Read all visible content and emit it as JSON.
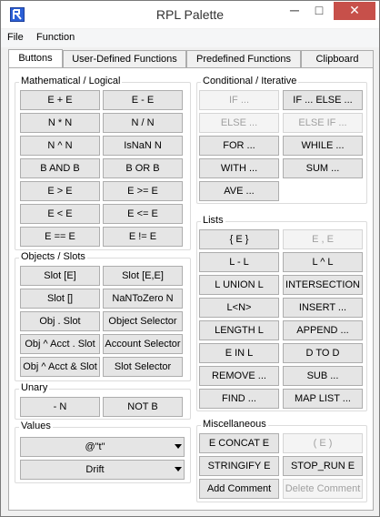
{
  "window": {
    "title": "RPL Palette",
    "min": "─",
    "max": "□",
    "close": "✕"
  },
  "menu": [
    "File",
    "Function"
  ],
  "tabs": [
    "Buttons",
    "User-Defined Functions",
    "Predefined Functions",
    "Clipboard"
  ],
  "groups": {
    "math": {
      "title": "Mathematical / Logical",
      "buttons": [
        "E + E",
        "E - E",
        "N * N",
        "N / N",
        "N ^ N",
        "IsNaN N",
        "B AND B",
        "B OR B",
        "E > E",
        "E >= E",
        "E < E",
        "E <= E",
        "E == E",
        "E != E"
      ]
    },
    "objects": {
      "title": "Objects / Slots",
      "buttons": [
        "Slot [E]",
        "Slot [E,E]",
        "Slot []",
        "NaNToZero N",
        "Obj . Slot",
        "Object Selector",
        "Obj ^ Acct . Slot",
        "Account Selector",
        "Obj ^ Acct & Slot",
        "Slot Selector"
      ]
    },
    "unary": {
      "title": "Unary",
      "buttons": [
        "- N",
        "NOT B"
      ]
    },
    "values": {
      "title": "Values",
      "combos": [
        "@\"t\"",
        "Drift"
      ]
    },
    "conditional": {
      "title": "Conditional / Iterative",
      "buttons": [
        "IF ...",
        "IF ... ELSE ...",
        "ELSE ...",
        "ELSE IF ...",
        "FOR ...",
        "WHILE ...",
        "WITH ...",
        "SUM ...",
        "AVE ..."
      ],
      "disabled": [
        true,
        false,
        true,
        true,
        false,
        false,
        false,
        false,
        false
      ]
    },
    "lists": {
      "title": "Lists",
      "buttons": [
        "{ E }",
        "E , E",
        "L - L",
        "L ^ L",
        "L UNION L",
        "INTERSECTION",
        "L<N>",
        "INSERT ...",
        "LENGTH L",
        "APPEND ...",
        "E IN L",
        "D TO D",
        "REMOVE ...",
        "SUB ...",
        "FIND ...",
        "MAP LIST ..."
      ],
      "disabled": [
        false,
        true,
        false,
        false,
        false,
        false,
        false,
        false,
        false,
        false,
        false,
        false,
        false,
        false,
        false,
        false
      ]
    },
    "misc": {
      "title": "Miscellaneous",
      "buttons": [
        "E CONCAT E",
        "( E )",
        "STRINGIFY E",
        "STOP_RUN E",
        "Add Comment",
        "Delete Comment"
      ],
      "disabled": [
        false,
        true,
        false,
        false,
        false,
        true
      ]
    }
  }
}
